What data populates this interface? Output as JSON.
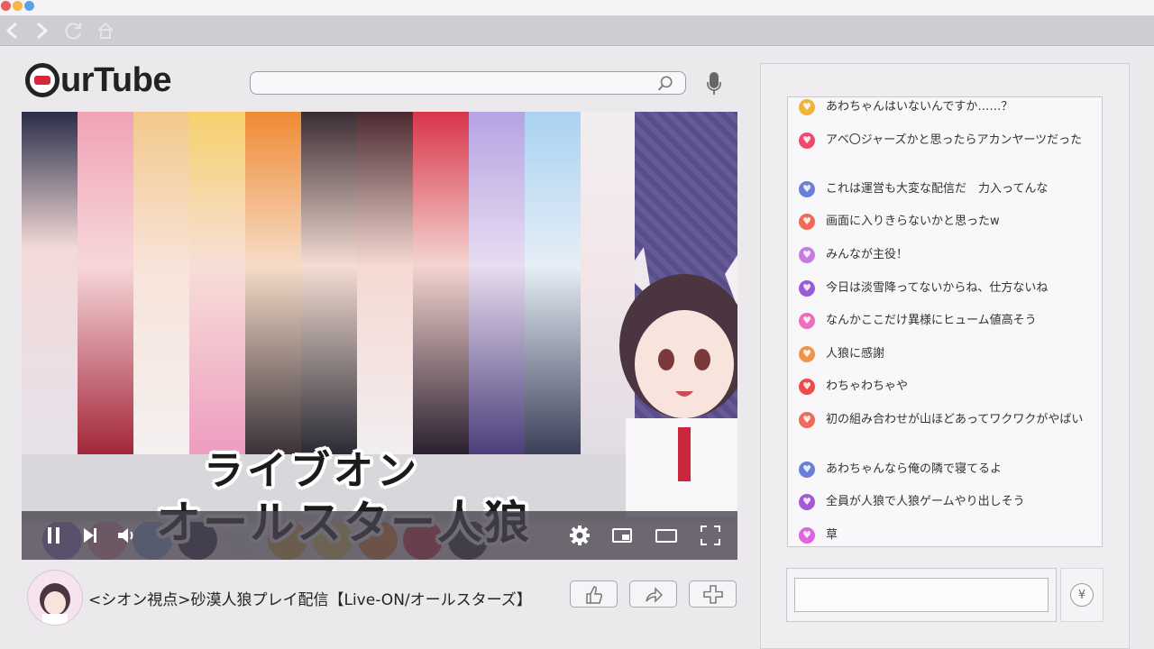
{
  "browser": {
    "window_dots": [
      {
        "name": "close-dot",
        "color": "#ee5d5a"
      },
      {
        "name": "minimize-dot",
        "color": "#f4b84b"
      },
      {
        "name": "maximize-dot",
        "color": "#5aa2e8"
      }
    ],
    "nav_icons": [
      "back-arrow-icon",
      "forward-arrow-icon",
      "reload-icon",
      "home-icon"
    ]
  },
  "site": {
    "logo_text": "urTube",
    "logo_accent": "#d8263a"
  },
  "search": {
    "value": "",
    "placeholder": ""
  },
  "video": {
    "overlay_line1": "ライブオン",
    "overlay_line2": "オールスター人狼",
    "title": "<シオン視点>砂漠人狼プレイ配信【Live-ON/オールスターズ】",
    "controls": [
      "pause-icon",
      "next-icon",
      "volume-icon",
      "settings-icon",
      "miniplayer-icon",
      "theater-icon",
      "fullscreen-icon"
    ]
  },
  "actions": [
    "like-icon",
    "share-icon",
    "add-icon"
  ],
  "chat": {
    "messages": [
      {
        "text": "あわちゃんはいないんですか……？",
        "color": "#f2b33d"
      },
      {
        "text": "アベ〇ジャーズかと思ったらアカンヤーツだった",
        "color": "#ef4a6c"
      },
      {
        "text": "これは運営も大変な配信だ　力入ってんな",
        "color": "#6a7fd8"
      },
      {
        "text": "画面に入りきらないかと思ったw",
        "color": "#ef6a5a"
      },
      {
        "text": "みんなが主役！",
        "color": "#c77be0"
      },
      {
        "text": "今日は淡雪降ってないからね、仕方ないね",
        "color": "#9b5ad8"
      },
      {
        "text": "なんかここだけ異様にヒューム値高そう",
        "color": "#ec6fb7"
      },
      {
        "text": "人狼に感謝",
        "color": "#f0944a"
      },
      {
        "text": "わちゃわちゃや",
        "color": "#ee4a4a"
      },
      {
        "text": "初の組み合わせが山ほどあってワクワクがやばい",
        "color": "#ef6a5a"
      },
      {
        "text": "あわちゃんなら俺の隣で寝てるよ",
        "color": "#6a7fd8"
      },
      {
        "text": "全員が人狼で人狼ゲームやり出しそう",
        "color": "#a25ad8"
      },
      {
        "text": "草",
        "color": "#dd66e0"
      }
    ],
    "input_value": "",
    "superchat_symbol": "¥"
  }
}
